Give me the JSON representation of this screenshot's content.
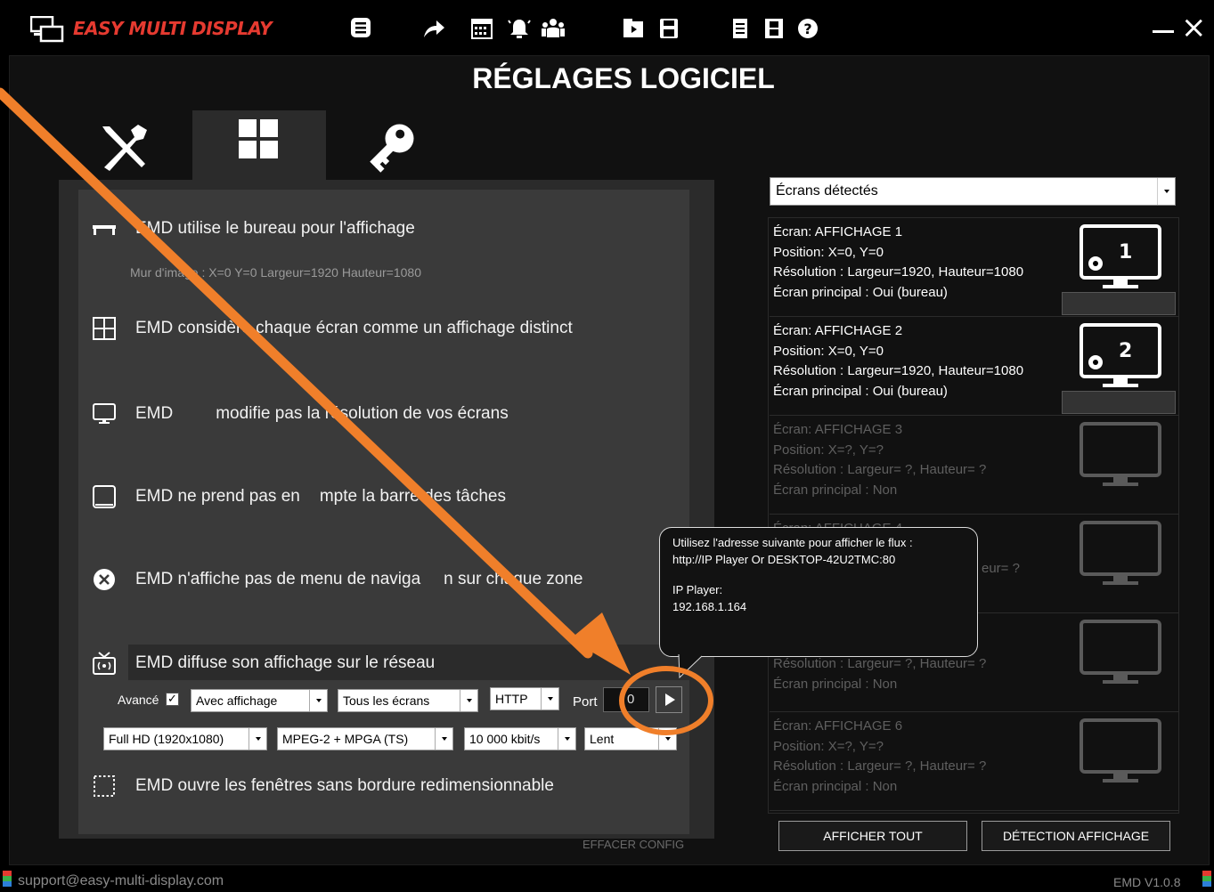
{
  "app": {
    "brand": "EASY MULTI DISPLAY",
    "page_title": "RÉGLAGES LOGICIEL",
    "brand_color": "#e53a30",
    "accent_color": "#f07f2a"
  },
  "toolbar": {
    "icons": [
      "screen-list-icon",
      "share-arrow-icon",
      "calendar-icon",
      "alarm-icon",
      "users-icon",
      "media-folder-icon",
      "save-icon",
      "document-icon",
      "film-icon",
      "help-icon"
    ]
  },
  "tabs": [
    "tools-icon",
    "screens-grid-icon",
    "license-key-icon"
  ],
  "options": {
    "desktop": "EMD utilise le bureau pour l'affichage",
    "wall_info": "Mur d'image : X=0  Y=0  Largeur=1920  Hauteur=1080",
    "distinct": "EMD considère chaque écran comme un affichage distinct",
    "resolution": "EMD ne modifie pas la résolution de vos écrans",
    "resolution_pre": "EMD",
    "resolution_post": "modifie pas la résolution de vos écrans",
    "taskbar_pre": "EMD ne prend pas en",
    "taskbar_post": "mpte la barre des tâches",
    "nav_pre": "EMD n'affiche pas de menu de naviga",
    "nav_post": "n sur chaque zone",
    "stream": "EMD diffuse son affichage sur le réseau",
    "borderless": "EMD ouvre les fenêtres sans bordure redimensionnable"
  },
  "stream_settings": {
    "advanced_label": "Avancé",
    "advanced_checked": true,
    "display_mode": "Avec affichage",
    "screens": "Tous les écrans",
    "protocol": "HTTP",
    "port_label": "Port",
    "port_value": "0",
    "resolution": "Full HD (1920x1080)",
    "codec": "MPEG-2 + MPGA (TS)",
    "bitrate": "10 000 kbit/s",
    "speed": "Lent"
  },
  "clear_config": "EFFACER CONFIG",
  "screens_select": "Écrans détectés",
  "screens": [
    {
      "l1": "Écran: AFFICHAGE 1",
      "l2": "Position: X=0, Y=0",
      "l3": "Résolution : Largeur=1920, Hauteur=1080",
      "l4": "Écran principal : Oui  (bureau)",
      "num": "1"
    },
    {
      "l1": "Écran: AFFICHAGE 2",
      "l2": "Position: X=0, Y=0",
      "l3": "Résolution : Largeur=1920, Hauteur=1080",
      "l4": "Écran principal : Oui  (bureau)",
      "num": "2"
    },
    {
      "l1": "Écran: AFFICHAGE 3",
      "l2": "Position: X=?, Y=?",
      "l3": "Résolution : Largeur= ?, Hauteur= ?",
      "l4": "Écran principal : Non"
    },
    {
      "l1": "Écran: AFFICHAGE 4",
      "l3_tail": "eur= ?"
    },
    {
      "l3": "Résolution : Largeur= ?, Hauteur= ?",
      "l4": "Écran principal : Non"
    },
    {
      "l1": "Écran: AFFICHAGE 6",
      "l2": "Position: X=?, Y=?",
      "l3": "Résolution : Largeur= ?, Hauteur= ?",
      "l4": "Écran principal : Non"
    }
  ],
  "buttons": {
    "show_all": "AFFICHER TOUT",
    "detect": "DÉTECTION AFFICHAGE"
  },
  "tooltip": {
    "line1": "Utilisez l'adresse suivante pour afficher le flux :",
    "line2": "http://IP Player Or DESKTOP-42U2TMC:80",
    "line3": " IP Player:",
    "line4": "192.168.1.164"
  },
  "status": {
    "email": "support@easy-multi-display.com",
    "version": "EMD V1.0.8"
  }
}
